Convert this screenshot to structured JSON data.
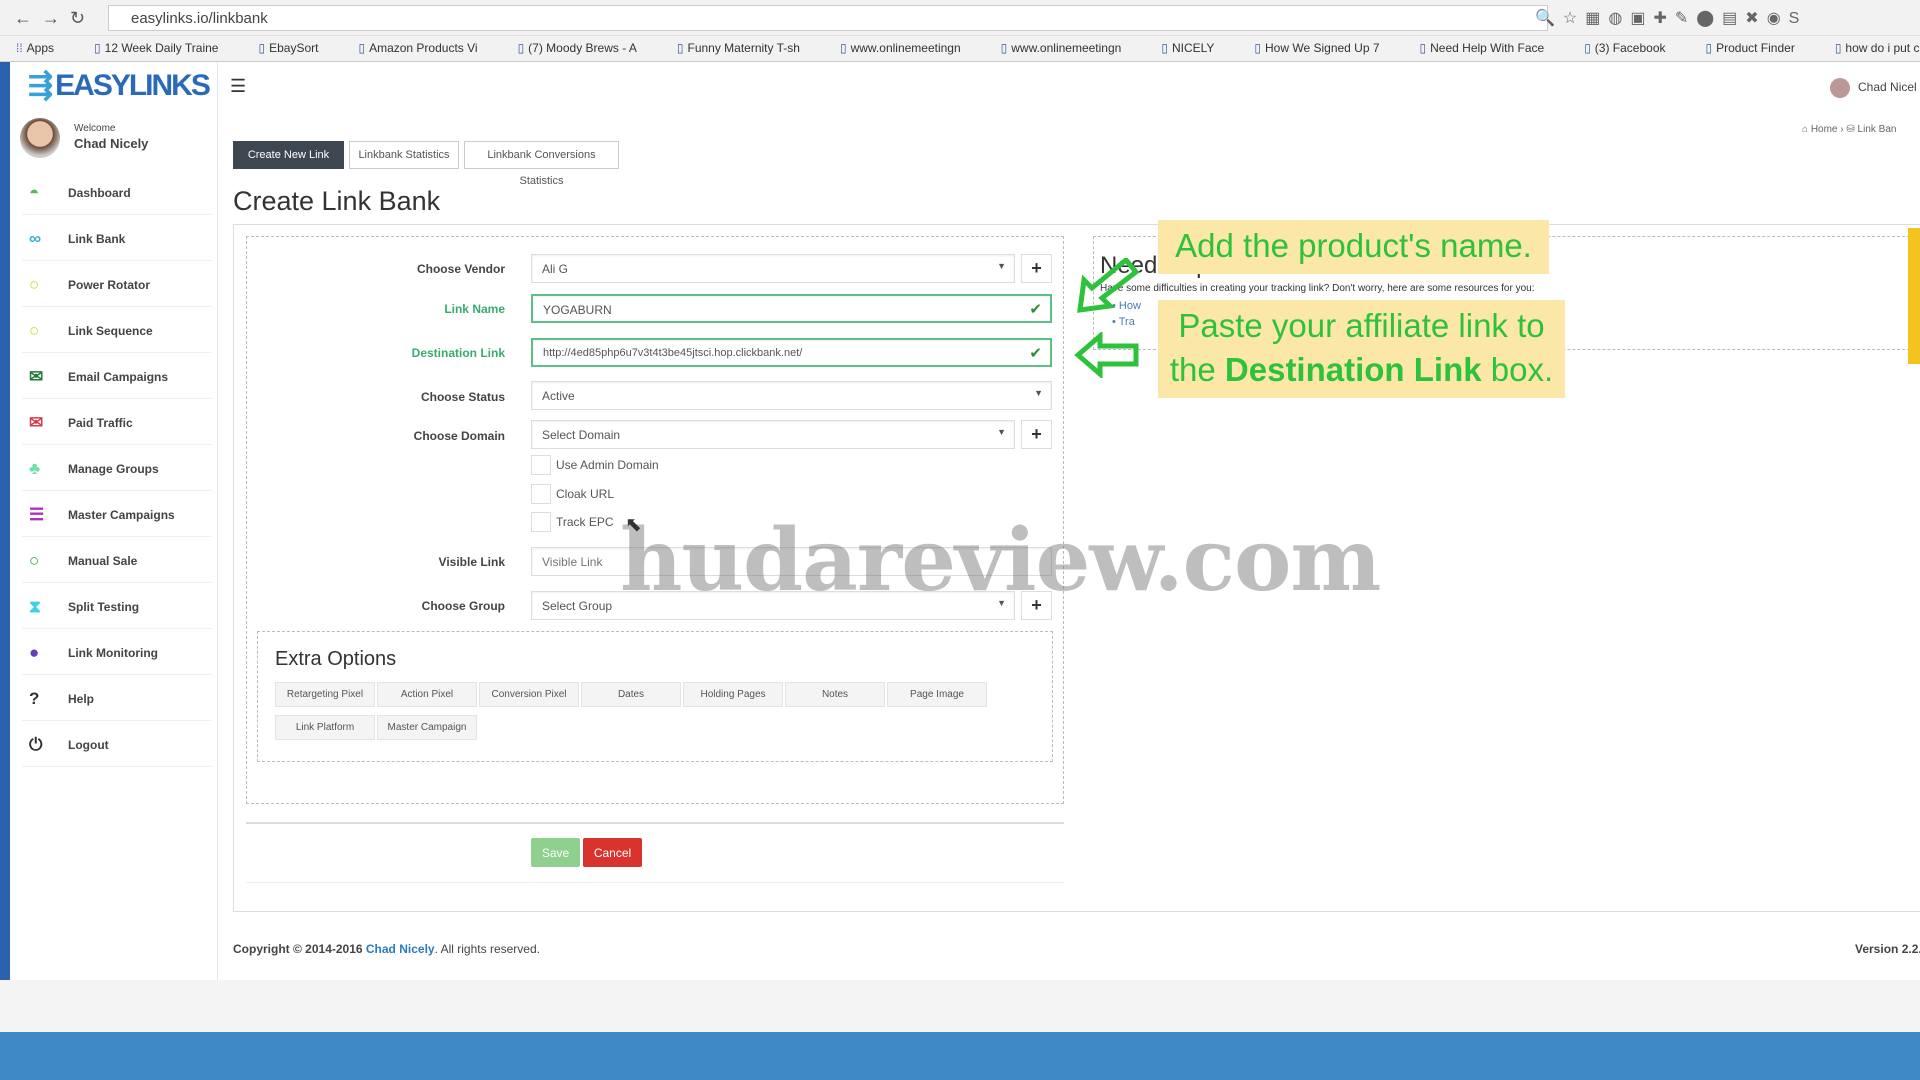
{
  "browser": {
    "url": "easylinks.io/linkbank",
    "bookmarks": [
      "Apps",
      "12 Week Daily Traine",
      "EbaySort",
      "Amazon Products Vi",
      "(7) Moody Brews - A",
      "Funny Maternity T-sh",
      "www.onlinemeetingn",
      "www.onlinemeetingn",
      "NICELY",
      "How We Signed Up 7",
      "Need Help With Face",
      "(3) Facebook",
      "Product Finder",
      "how do i put credit c"
    ]
  },
  "sidebar": {
    "logo": "EASYLINKS",
    "welcome": "Welcome",
    "user": "Chad Nicely",
    "items": [
      {
        "label": "Dashboard",
        "icon": "dashboard-icon",
        "glyph": "◓",
        "color": "#5cb85c"
      },
      {
        "label": "Link Bank",
        "icon": "link-icon",
        "glyph": "∞",
        "color": "#3ab0d0"
      },
      {
        "label": "Power Rotator",
        "icon": "circle-icon",
        "glyph": "○",
        "color": "#c8d82a"
      },
      {
        "label": "Link Sequence",
        "icon": "circle-icon",
        "glyph": "○",
        "color": "#c8d82a"
      },
      {
        "label": "Email Campaigns",
        "icon": "envelope-icon",
        "glyph": "✉",
        "color": "#1e7a3a"
      },
      {
        "label": "Paid Traffic",
        "icon": "envelope-outline-icon",
        "glyph": "✉",
        "color": "#d04050"
      },
      {
        "label": "Manage Groups",
        "icon": "groups-icon",
        "glyph": "♣",
        "color": "#6ee0a8"
      },
      {
        "label": "Master Campaigns",
        "icon": "list-icon",
        "glyph": "☰",
        "color": "#b030c0"
      },
      {
        "label": "Manual Sale",
        "icon": "circle-icon",
        "glyph": "○",
        "color": "#2e9a3a"
      },
      {
        "label": "Split Testing",
        "icon": "hourglass-icon",
        "glyph": "⧗",
        "color": "#40d0e0"
      },
      {
        "label": "Link Monitoring",
        "icon": "globe-icon",
        "glyph": "●",
        "color": "#6040c0"
      },
      {
        "label": "Help",
        "icon": "question-icon",
        "glyph": "?",
        "color": "#333"
      },
      {
        "label": "Logout",
        "icon": "power-icon",
        "glyph": "⏻",
        "color": "#333"
      }
    ]
  },
  "header": {
    "user": "Chad Nicel",
    "breadcrumb": "⌂ Home › ⛁ Link Ban"
  },
  "tabs": [
    "Create New Link",
    "Linkbank Statistics",
    "Linkbank Conversions Statistics"
  ],
  "page_title": "Create Link Bank",
  "form": {
    "vendor_label": "Choose Vendor",
    "vendor_value": "Ali G",
    "link_name_label": "Link Name",
    "link_name_value": "YOGABURN",
    "dest_label": "Destination Link",
    "dest_value": "http://4ed85php6u7v3t4t3be45jtsci.hop.clickbank.net/",
    "status_label": "Choose Status",
    "status_value": "Active",
    "domain_label": "Choose Domain",
    "domain_value": "Select Domain",
    "checkboxes": [
      "Use Admin Domain",
      "Cloak URL",
      "Track EPC"
    ],
    "visible_label": "Visible Link",
    "visible_placeholder": "Visible Link",
    "group_label": "Choose Group",
    "group_value": "Select Group"
  },
  "extra": {
    "title": "Extra Options",
    "buttons": [
      "Retargeting Pixel",
      "Action Pixel",
      "Conversion Pixel",
      "Dates",
      "Holding Pages",
      "Notes",
      "Page Image",
      "Link Platform",
      "Master Campaign"
    ]
  },
  "actions": {
    "save": "Save",
    "cancel": "Cancel"
  },
  "help": {
    "title": "Need help?",
    "text": "Have some difficulties in creating your tracking link? Don't worry, here are some resources for you:",
    "links": [
      "How",
      "Tra"
    ]
  },
  "footer": {
    "prefix": "Copyright © 2014-2016 ",
    "author": "Chad Nicely",
    "suffix": ". All rights reserved.",
    "version": "Version 2.2."
  },
  "callouts": {
    "first": "Add the product's name.",
    "second_a": "Paste your affiliate link to",
    "second_b": "the ",
    "second_bold": "Destination Link",
    "second_c": " box.",
    "color": "#2ec23c"
  },
  "watermark": "hudareview.com"
}
